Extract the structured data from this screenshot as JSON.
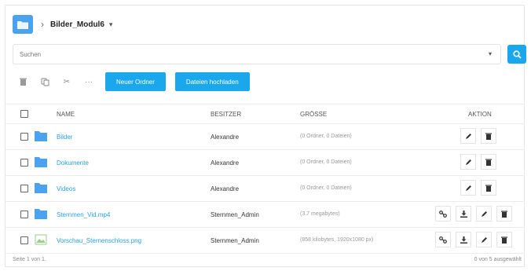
{
  "breadcrumb": {
    "current": "Bilder_Modul6"
  },
  "search": {
    "placeholder": "Suchen"
  },
  "toolbar": {
    "new_folder_label": "Neuer Ordner",
    "upload_label": "Dateien hochladen"
  },
  "table": {
    "headers": {
      "name": "NAME",
      "owner": "BESITZER",
      "size": "GRÖSSE",
      "action": "AKTION"
    },
    "rows": [
      {
        "name": "Bilder",
        "owner": "Alexandre",
        "size": "(0 Ordner, 0 Dateien)",
        "type": "folder"
      },
      {
        "name": "Dokumente",
        "owner": "Alexandre",
        "size": "(0 Ordner, 0 Dateien)",
        "type": "folder"
      },
      {
        "name": "Videos",
        "owner": "Alexandre",
        "size": "(0 Ordner, 0 Dateien)",
        "type": "folder"
      },
      {
        "name": "Sternmen_Vid.mp4",
        "owner": "Sternmen_Admin",
        "size": "(3.7 megabytes)",
        "type": "video"
      },
      {
        "name": "Vorschau_Sternenschloss.png",
        "owner": "Sternmen_Admin",
        "size": "(858 kilobytes, 1920x1080 px)",
        "type": "image"
      }
    ]
  },
  "footer": {
    "pagination": "Seite 1 von 1.",
    "selection": "0 von 5 ausgewählt"
  },
  "colors": {
    "accent": "#1aa7ec",
    "folder": "#4aa3ec",
    "link": "#2a9fe0"
  }
}
